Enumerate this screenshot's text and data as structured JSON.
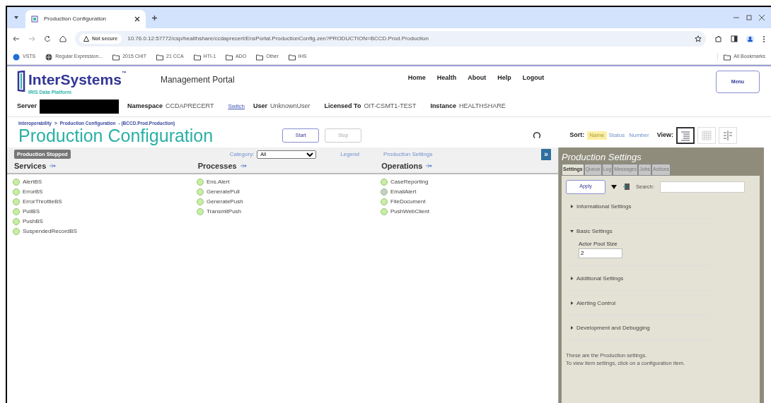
{
  "browser": {
    "tab_title": "Production Configuration",
    "address_warning": "Not secure",
    "url": "10.76.0.12:57772/csp/healthshare/ccdaprecert/EnsPortal.ProductionConfig.zen?PRODUCTION=BCCD.Prod.Production",
    "bookmarks": [
      {
        "label": "VSTS",
        "kind": "app"
      },
      {
        "label": "Regular Expression...",
        "kind": "globe"
      },
      {
        "label": "2015 CHIT",
        "kind": "folder"
      },
      {
        "label": "21 CCA",
        "kind": "folder"
      },
      {
        "label": "HTI-1",
        "kind": "folder"
      },
      {
        "label": "ADO",
        "kind": "folder"
      },
      {
        "label": "Other",
        "kind": "folder"
      },
      {
        "label": "IHS",
        "kind": "folder"
      }
    ],
    "all_bookmarks": "All Bookmarks"
  },
  "header": {
    "logo": "InterSystems",
    "logo_tm": "™",
    "logo_sub": "IRIS Data Platform",
    "portal": "Management Portal",
    "nav": [
      "Home",
      "Health",
      "About",
      "Help",
      "Logout"
    ],
    "menu_button": "Menu",
    "info": [
      {
        "label": "Server",
        "kind": "redacted"
      },
      {
        "label": "Namespace",
        "value": "CCDAPRECERT",
        "kind": "text"
      },
      {
        "label": "Switch",
        "kind": "link"
      },
      {
        "label": "User",
        "value": "UnknownUser",
        "kind": "text"
      },
      {
        "label": "Licensed To",
        "value": "OIT-CSMT1-TEST",
        "kind": "text"
      },
      {
        "label": "Instance",
        "value": "HEALTHSHARE",
        "kind": "text"
      }
    ]
  },
  "breadcrumb": [
    "Interoperability",
    ">",
    "Production Configuration",
    "- (BCCD.Prod.Production)"
  ],
  "title": "Production Configuration",
  "actions": [
    {
      "label": "Start",
      "disabled": false
    },
    {
      "label": "Stop",
      "disabled": true
    }
  ],
  "sort": {
    "label": "Sort:",
    "options": [
      {
        "label": "Name",
        "selected": true
      },
      {
        "label": "Status",
        "selected": false
      },
      {
        "label": "Number",
        "selected": false
      }
    ]
  },
  "view": {
    "label": "View:",
    "options": [
      {
        "kind": "list",
        "selected": true
      },
      {
        "kind": "grid",
        "selected": false
      },
      {
        "kind": "columns",
        "selected": false
      }
    ]
  },
  "toolbar": {
    "status": "Production Stopped",
    "category_label": "Category:",
    "category_value": "All",
    "links": [
      "Legend",
      "Production Settings"
    ],
    "expand": "»"
  },
  "columns": [
    {
      "title": "Services",
      "items": [
        {
          "name": "AlertBS",
          "color": "#c6f0a0"
        },
        {
          "name": "ErrorBS",
          "color": "#c6f0a0"
        },
        {
          "name": "ErrorThrottleBS",
          "color": "#c6f0a0"
        },
        {
          "name": "PullBS",
          "color": "#c6f0a0"
        },
        {
          "name": "PushBS",
          "color": "#c6f0a0"
        },
        {
          "name": "SuspendedRecordBS",
          "color": "#c6f0a0"
        }
      ]
    },
    {
      "title": "Processes",
      "items": [
        {
          "name": "Ens.Alert",
          "color": "#c6f0a0"
        },
        {
          "name": "GeneratePull",
          "color": "#c6f0a0"
        },
        {
          "name": "GeneratePush",
          "color": "#c6f0a0"
        },
        {
          "name": "TransmitPush",
          "color": "#c6f0a0"
        }
      ]
    },
    {
      "title": "Operations",
      "items": [
        {
          "name": "CaseReporting",
          "color": "#c6f0a0"
        },
        {
          "name": "EmailAlert",
          "color": "#cccccc"
        },
        {
          "name": "FileDocument",
          "color": "#c6f0a0"
        },
        {
          "name": "PushWebClient",
          "color": "#c6f0a0"
        }
      ]
    }
  ],
  "settings_panel": {
    "title": "Production Settings",
    "tabs": [
      {
        "label": "Settings",
        "selected": true
      },
      {
        "label": "Queue",
        "selected": false
      },
      {
        "label": "Log",
        "selected": false
      },
      {
        "label": "Messages",
        "selected": false
      },
      {
        "label": "Jobs",
        "selected": false
      },
      {
        "label": "Actions",
        "selected": false
      }
    ],
    "apply": "Apply",
    "search_label": "Search:",
    "sections": [
      {
        "title": "Informational Settings",
        "expanded": false
      },
      {
        "title": "Basic Settings",
        "expanded": true,
        "fields": [
          {
            "label": "Actor Pool Size",
            "value": "2"
          }
        ]
      },
      {
        "title": "Additional Settings",
        "expanded": false
      },
      {
        "title": "Alerting Control",
        "expanded": false
      },
      {
        "title": "Development and Debugging",
        "expanded": false
      }
    ],
    "note": [
      "These are the Production settings.",
      "To view item settings, click on a configuration item."
    ]
  }
}
